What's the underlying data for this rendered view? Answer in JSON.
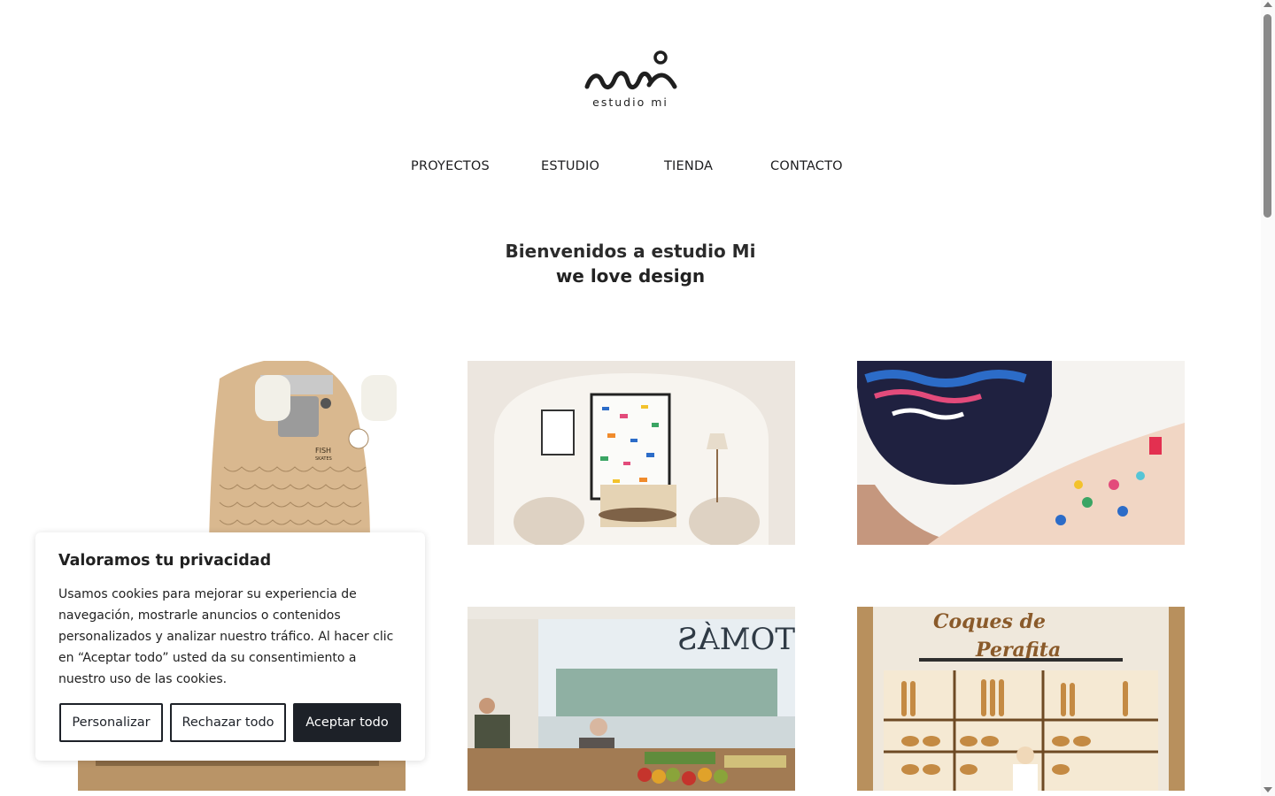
{
  "brand": {
    "wordmark": "estudio mi",
    "logo_icon": "mi-wave-logo-icon"
  },
  "nav": {
    "items": [
      {
        "label": "PROYECTOS"
      },
      {
        "label": "ESTUDIO"
      },
      {
        "label": "TIENDA"
      },
      {
        "label": "CONTACTO"
      }
    ]
  },
  "hero": {
    "title": "Bienvenidos a estudio Mi",
    "subtitle": "we love design"
  },
  "projects": [
    {
      "image": "fish-skateboard-photo"
    },
    {
      "image": "interior-artwork-photo"
    },
    {
      "image": "painted-cap-and-pouch-photo"
    },
    {
      "image": "wood-interior-photo"
    },
    {
      "image": "tomas-greengrocer-shop-photo"
    },
    {
      "image": "coques-de-perafita-bakery-photo"
    }
  ],
  "tile_text": {
    "skate_brand": "FISH",
    "skate_sub": "SKATES",
    "shop_sign": "TOMÁS",
    "bakery_line1": "Coques de",
    "bakery_line2": "Perafita"
  },
  "cookie": {
    "title": "Valoramos tu privacidad",
    "body": "Usamos cookies para mejorar su experiencia de navegación, mostrarle anuncios o contenidos personalizados y analizar nuestro tráfico. Al hacer clic en “Aceptar todo” usted da su consentimiento a nuestro uso de las cookies.",
    "buttons": {
      "customize": "Personalizar",
      "reject": "Rechazar todo",
      "accept": "Aceptar todo"
    }
  },
  "colors": {
    "text": "#1d1d1f",
    "button_dark": "#1d2128",
    "background": "#ffffff"
  }
}
